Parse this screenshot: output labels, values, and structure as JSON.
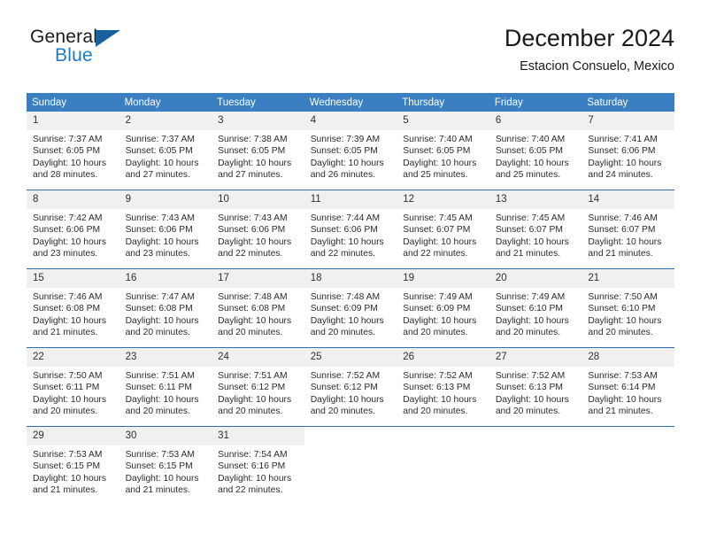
{
  "brand": {
    "word_one": "General",
    "word_two": "Blue",
    "triangle_icon": "brand-triangle-icon"
  },
  "header": {
    "title": "December 2024",
    "subtitle": "Estacion Consuelo, Mexico"
  },
  "calendar": {
    "weekday_headers": [
      "Sunday",
      "Monday",
      "Tuesday",
      "Wednesday",
      "Thursday",
      "Friday",
      "Saturday"
    ],
    "accent_color": "#3a7fc1",
    "border_color": "#2f6fb0",
    "daynum_bg": "#f0f0f0",
    "weeks": [
      [
        {
          "day": "1",
          "sunrise": "Sunrise: 7:37 AM",
          "sunset": "Sunset: 6:05 PM",
          "daylight_1": "Daylight: 10 hours",
          "daylight_2": "and 28 minutes."
        },
        {
          "day": "2",
          "sunrise": "Sunrise: 7:37 AM",
          "sunset": "Sunset: 6:05 PM",
          "daylight_1": "Daylight: 10 hours",
          "daylight_2": "and 27 minutes."
        },
        {
          "day": "3",
          "sunrise": "Sunrise: 7:38 AM",
          "sunset": "Sunset: 6:05 PM",
          "daylight_1": "Daylight: 10 hours",
          "daylight_2": "and 27 minutes."
        },
        {
          "day": "4",
          "sunrise": "Sunrise: 7:39 AM",
          "sunset": "Sunset: 6:05 PM",
          "daylight_1": "Daylight: 10 hours",
          "daylight_2": "and 26 minutes."
        },
        {
          "day": "5",
          "sunrise": "Sunrise: 7:40 AM",
          "sunset": "Sunset: 6:05 PM",
          "daylight_1": "Daylight: 10 hours",
          "daylight_2": "and 25 minutes."
        },
        {
          "day": "6",
          "sunrise": "Sunrise: 7:40 AM",
          "sunset": "Sunset: 6:05 PM",
          "daylight_1": "Daylight: 10 hours",
          "daylight_2": "and 25 minutes."
        },
        {
          "day": "7",
          "sunrise": "Sunrise: 7:41 AM",
          "sunset": "Sunset: 6:06 PM",
          "daylight_1": "Daylight: 10 hours",
          "daylight_2": "and 24 minutes."
        }
      ],
      [
        {
          "day": "8",
          "sunrise": "Sunrise: 7:42 AM",
          "sunset": "Sunset: 6:06 PM",
          "daylight_1": "Daylight: 10 hours",
          "daylight_2": "and 23 minutes."
        },
        {
          "day": "9",
          "sunrise": "Sunrise: 7:43 AM",
          "sunset": "Sunset: 6:06 PM",
          "daylight_1": "Daylight: 10 hours",
          "daylight_2": "and 23 minutes."
        },
        {
          "day": "10",
          "sunrise": "Sunrise: 7:43 AM",
          "sunset": "Sunset: 6:06 PM",
          "daylight_1": "Daylight: 10 hours",
          "daylight_2": "and 22 minutes."
        },
        {
          "day": "11",
          "sunrise": "Sunrise: 7:44 AM",
          "sunset": "Sunset: 6:06 PM",
          "daylight_1": "Daylight: 10 hours",
          "daylight_2": "and 22 minutes."
        },
        {
          "day": "12",
          "sunrise": "Sunrise: 7:45 AM",
          "sunset": "Sunset: 6:07 PM",
          "daylight_1": "Daylight: 10 hours",
          "daylight_2": "and 22 minutes."
        },
        {
          "day": "13",
          "sunrise": "Sunrise: 7:45 AM",
          "sunset": "Sunset: 6:07 PM",
          "daylight_1": "Daylight: 10 hours",
          "daylight_2": "and 21 minutes."
        },
        {
          "day": "14",
          "sunrise": "Sunrise: 7:46 AM",
          "sunset": "Sunset: 6:07 PM",
          "daylight_1": "Daylight: 10 hours",
          "daylight_2": "and 21 minutes."
        }
      ],
      [
        {
          "day": "15",
          "sunrise": "Sunrise: 7:46 AM",
          "sunset": "Sunset: 6:08 PM",
          "daylight_1": "Daylight: 10 hours",
          "daylight_2": "and 21 minutes."
        },
        {
          "day": "16",
          "sunrise": "Sunrise: 7:47 AM",
          "sunset": "Sunset: 6:08 PM",
          "daylight_1": "Daylight: 10 hours",
          "daylight_2": "and 20 minutes."
        },
        {
          "day": "17",
          "sunrise": "Sunrise: 7:48 AM",
          "sunset": "Sunset: 6:08 PM",
          "daylight_1": "Daylight: 10 hours",
          "daylight_2": "and 20 minutes."
        },
        {
          "day": "18",
          "sunrise": "Sunrise: 7:48 AM",
          "sunset": "Sunset: 6:09 PM",
          "daylight_1": "Daylight: 10 hours",
          "daylight_2": "and 20 minutes."
        },
        {
          "day": "19",
          "sunrise": "Sunrise: 7:49 AM",
          "sunset": "Sunset: 6:09 PM",
          "daylight_1": "Daylight: 10 hours",
          "daylight_2": "and 20 minutes."
        },
        {
          "day": "20",
          "sunrise": "Sunrise: 7:49 AM",
          "sunset": "Sunset: 6:10 PM",
          "daylight_1": "Daylight: 10 hours",
          "daylight_2": "and 20 minutes."
        },
        {
          "day": "21",
          "sunrise": "Sunrise: 7:50 AM",
          "sunset": "Sunset: 6:10 PM",
          "daylight_1": "Daylight: 10 hours",
          "daylight_2": "and 20 minutes."
        }
      ],
      [
        {
          "day": "22",
          "sunrise": "Sunrise: 7:50 AM",
          "sunset": "Sunset: 6:11 PM",
          "daylight_1": "Daylight: 10 hours",
          "daylight_2": "and 20 minutes."
        },
        {
          "day": "23",
          "sunrise": "Sunrise: 7:51 AM",
          "sunset": "Sunset: 6:11 PM",
          "daylight_1": "Daylight: 10 hours",
          "daylight_2": "and 20 minutes."
        },
        {
          "day": "24",
          "sunrise": "Sunrise: 7:51 AM",
          "sunset": "Sunset: 6:12 PM",
          "daylight_1": "Daylight: 10 hours",
          "daylight_2": "and 20 minutes."
        },
        {
          "day": "25",
          "sunrise": "Sunrise: 7:52 AM",
          "sunset": "Sunset: 6:12 PM",
          "daylight_1": "Daylight: 10 hours",
          "daylight_2": "and 20 minutes."
        },
        {
          "day": "26",
          "sunrise": "Sunrise: 7:52 AM",
          "sunset": "Sunset: 6:13 PM",
          "daylight_1": "Daylight: 10 hours",
          "daylight_2": "and 20 minutes."
        },
        {
          "day": "27",
          "sunrise": "Sunrise: 7:52 AM",
          "sunset": "Sunset: 6:13 PM",
          "daylight_1": "Daylight: 10 hours",
          "daylight_2": "and 20 minutes."
        },
        {
          "day": "28",
          "sunrise": "Sunrise: 7:53 AM",
          "sunset": "Sunset: 6:14 PM",
          "daylight_1": "Daylight: 10 hours",
          "daylight_2": "and 21 minutes."
        }
      ],
      [
        {
          "day": "29",
          "sunrise": "Sunrise: 7:53 AM",
          "sunset": "Sunset: 6:15 PM",
          "daylight_1": "Daylight: 10 hours",
          "daylight_2": "and 21 minutes."
        },
        {
          "day": "30",
          "sunrise": "Sunrise: 7:53 AM",
          "sunset": "Sunset: 6:15 PM",
          "daylight_1": "Daylight: 10 hours",
          "daylight_2": "and 21 minutes."
        },
        {
          "day": "31",
          "sunrise": "Sunrise: 7:54 AM",
          "sunset": "Sunset: 6:16 PM",
          "daylight_1": "Daylight: 10 hours",
          "daylight_2": "and 22 minutes."
        },
        {
          "day": "",
          "sunrise": "",
          "sunset": "",
          "daylight_1": "",
          "daylight_2": ""
        },
        {
          "day": "",
          "sunrise": "",
          "sunset": "",
          "daylight_1": "",
          "daylight_2": ""
        },
        {
          "day": "",
          "sunrise": "",
          "sunset": "",
          "daylight_1": "",
          "daylight_2": ""
        },
        {
          "day": "",
          "sunrise": "",
          "sunset": "",
          "daylight_1": "",
          "daylight_2": ""
        }
      ]
    ]
  }
}
